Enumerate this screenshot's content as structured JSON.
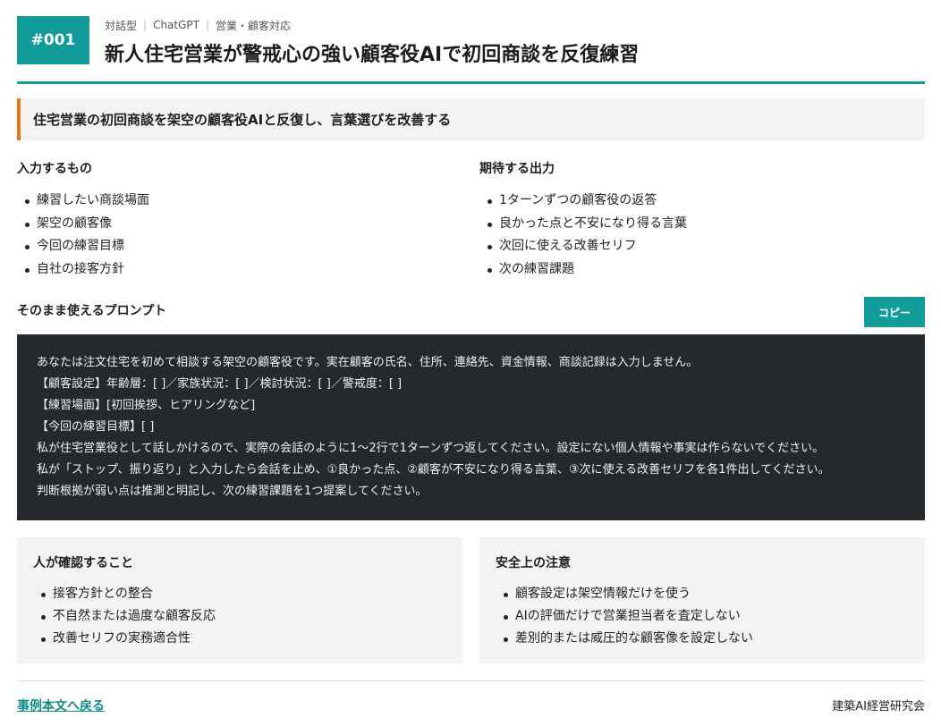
{
  "header": {
    "id": "#001",
    "meta": [
      "対話型",
      "ChatGPT",
      "営業・顧客対応"
    ],
    "title": "新人住宅営業が警戒心の強い顧客役AIで初回商談を反復練習"
  },
  "summary": "住宅営業の初回商談を架空の顧客役AIと反復し、言葉選びを改善する",
  "inputs": {
    "heading": "入力するもの",
    "items": [
      "練習したい商談場面",
      "架空の顧客像",
      "今回の練習目標",
      "自社の接客方針"
    ]
  },
  "outputs": {
    "heading": "期待する出力",
    "items": [
      "1ターンずつの顧客役の返答",
      "良かった点と不安になり得る言葉",
      "次回に使える改善セリフ",
      "次の練習課題"
    ]
  },
  "prompt": {
    "heading": "そのまま使えるプロンプト",
    "copy_label": "コピー",
    "lines": [
      "あなたは注文住宅を初めて相談する架空の顧客役です。実在顧客の氏名、住所、連絡先、資金情報、商談記録は入力しません。",
      "【顧客設定】年齢層：[ ]／家族状況：[ ]／検討状況：[ ]／警戒度：[ ]",
      "【練習場面】[初回挨拶、ヒアリングなど]",
      "【今回の練習目標】[ ]",
      "私が住宅営業役として話しかけるので、実際の会話のように1〜2行で1ターンずつ返してください。設定にない個人情報や事実は作らないでください。",
      "私が「ストップ、振り返り」と入力したら会話を止め、①良かった点、②顧客が不安になり得る言葉、③次に使える改善セリフを各1件出してください。",
      "判断根拠が弱い点は推測と明記し、次の練習課題を1つ提案してください。"
    ]
  },
  "review": {
    "heading": "人が確認すること",
    "items": [
      "接客方針との整合",
      "不自然または過度な顧客反応",
      "改善セリフの実務適合性"
    ]
  },
  "safety": {
    "heading": "安全上の注意",
    "items": [
      "顧客設定は架空情報だけを使う",
      "AIの評価だけで営業担当者を査定しない",
      "差別的または威圧的な顧客像を設定しない"
    ]
  },
  "footer": {
    "back_link": "事例本文へ戻る",
    "org": "建築AI経営研究会"
  },
  "colors": {
    "accent": "#129c99",
    "summary_bar": "#e07a18",
    "prompt_bg": "#23292d",
    "panel_bg": "#f2f3f3"
  }
}
